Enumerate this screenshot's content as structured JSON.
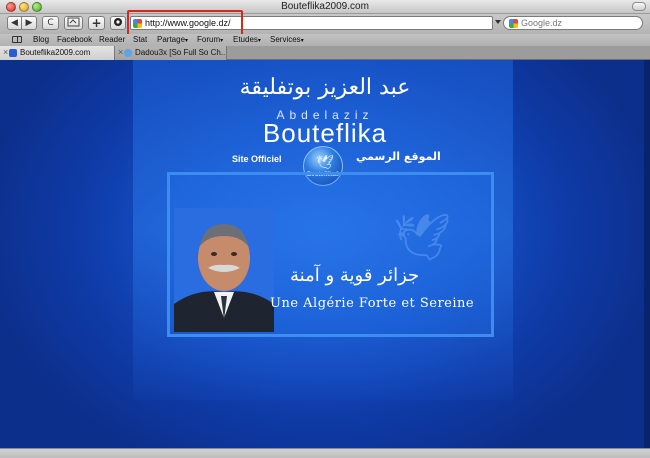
{
  "window": {
    "title": "Bouteflika2009.com"
  },
  "toolbar": {
    "back": "◀",
    "forward": "▶",
    "reload": "C",
    "add": "+",
    "url": "http://www.google.dz/",
    "search_placeholder": "Google.dz"
  },
  "bookmarks": {
    "items": [
      {
        "label": "Blog"
      },
      {
        "label": "Facebook"
      },
      {
        "label": "Reader"
      },
      {
        "label": "Stat"
      },
      {
        "label": "Partage"
      },
      {
        "label": "Forum"
      },
      {
        "label": "Etudes"
      },
      {
        "label": "Services"
      }
    ],
    "caret": "▾"
  },
  "tabs": [
    {
      "label": "Bouteflika2009.com"
    },
    {
      "label": "Dadou3x [So Full So Ch..."
    }
  ],
  "page": {
    "name_arabic": "عبد العزيز بوتفليقة",
    "name_first": "Abdelaziz",
    "name_last": "Bouteflika",
    "site_officiel": "Site Officiel",
    "site_arabic": "الموقع الرسمي",
    "logo_text": "Bouteflika9",
    "slogan_arabic": "جزائر قوية و آمنة",
    "slogan_french": "Une Algérie Forte et Sereine"
  },
  "colors": {
    "background": "#0d2f8a",
    "highlight": "#d6281e",
    "accent": "#3d8cf0"
  }
}
